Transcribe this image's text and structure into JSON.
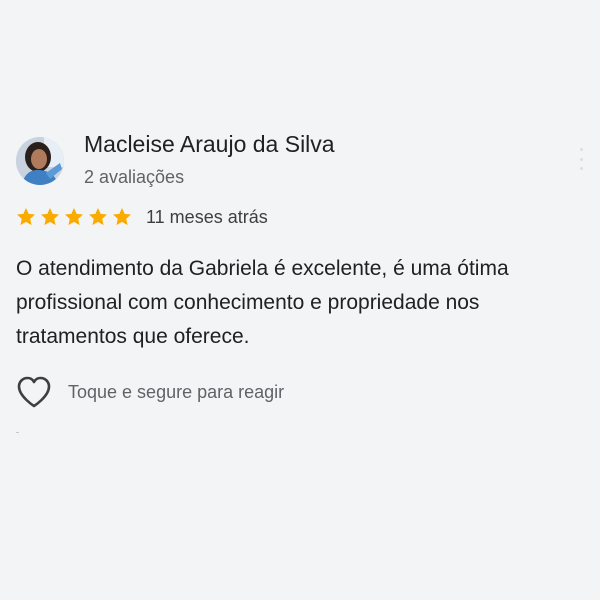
{
  "review": {
    "reviewer_name": "Macleise Araujo da Silva",
    "review_count": "2 avaliações",
    "rating": 5,
    "rating_max": 5,
    "star_color": "#f9ab00",
    "date": "11 meses atrás",
    "text": "O atendimento da Gabriela é excelente, é uma ótima profissional com conhecimento e propriedade nos tratamentos que oferece.",
    "react_prompt": "Toque e segure para reagir"
  },
  "icons": {
    "avatar": "user-photo",
    "star": "star-icon",
    "heart": "heart-outline-icon",
    "more": "more-vertical-icon"
  }
}
